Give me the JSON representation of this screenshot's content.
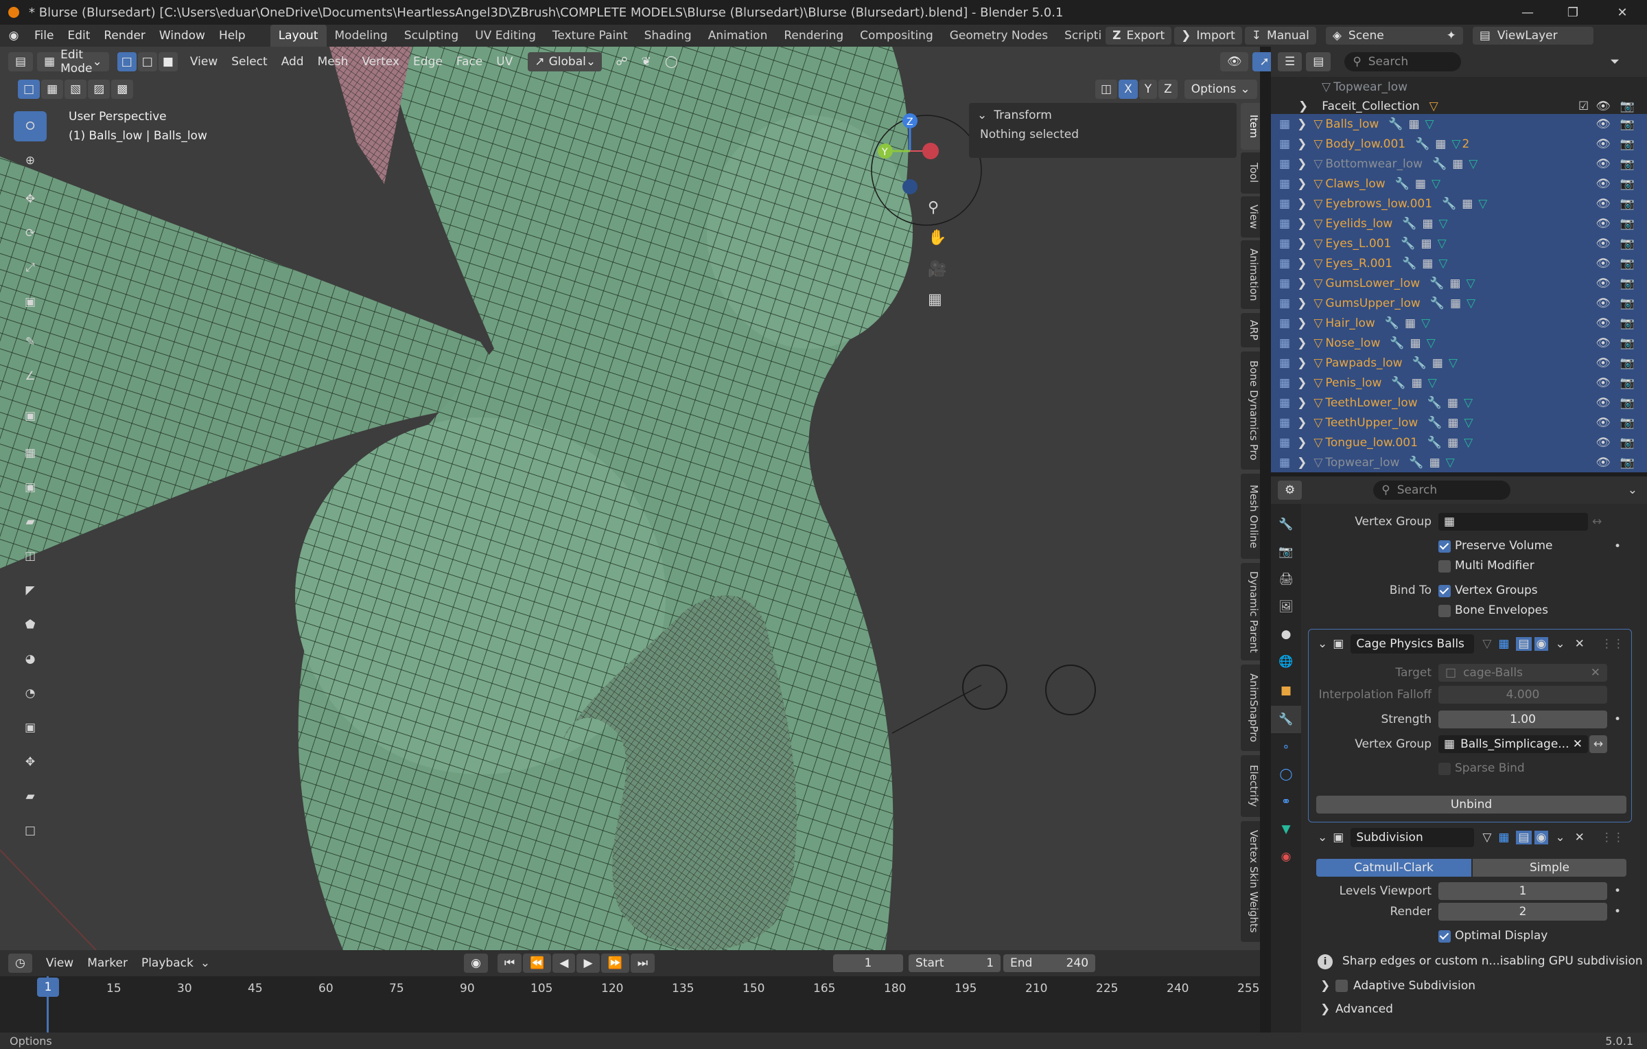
{
  "title_bar": {
    "text": "* Blurse (Blursedart) [C:\\Users\\eduar\\OneDrive\\Documents\\HeartlessAngel3D\\ZBrush\\COMPLETE MODELS\\Blurse (Blursedart)\\Blurse (Blursedart).blend] - Blender 5.0.1"
  },
  "menu": [
    "File",
    "Edit",
    "Render",
    "Window",
    "Help"
  ],
  "workspaces": [
    "Layout",
    "Modeling",
    "Sculpting",
    "UV Editing",
    "Texture Paint",
    "Shading",
    "Animation",
    "Rendering",
    "Compositing",
    "Geometry Nodes",
    "Scripting"
  ],
  "top_right": {
    "export": "Export",
    "import": "Import",
    "manual": "Manual",
    "scene": "Scene",
    "view_layer": "ViewLayer"
  },
  "viewport_header": {
    "mode": "Edit Mode",
    "menus": [
      "View",
      "Select",
      "Add",
      "Mesh",
      "Vertex",
      "Edge",
      "Face",
      "UV"
    ],
    "orientation": "Global",
    "options": "Options",
    "axes": [
      "X",
      "Y",
      "Z"
    ]
  },
  "viewport": {
    "perspective": "User Perspective",
    "object_info": "(1) Balls_low | Balls_low"
  },
  "n_panel": {
    "section": "Transform",
    "message": "Nothing selected",
    "tabs": [
      "Item",
      "Tool",
      "View",
      "Animation",
      "ARP",
      "Bone Dynamics Pro",
      "Mesh Online",
      "Dynamic Parent",
      "AnimSnapPro",
      "Electrify",
      "Vertex Skin Weights"
    ]
  },
  "outliner": {
    "search_placeholder": "Search",
    "top_partial": "Topwear_low",
    "collection": "Faceit_Collection",
    "items": [
      "Balls_low",
      "Body_low.001",
      "Bottomwear_low",
      "Claws_low",
      "Eyebrows_low.001",
      "Eyelids_low",
      "Eyes_L.001",
      "Eyes_R.001",
      "GumsLower_low",
      "GumsUpper_low",
      "Hair_low",
      "Nose_low",
      "Pawpads_low",
      "Penis_low",
      "TeethLower_low",
      "TeethUpper_low",
      "Tongue_low.001",
      "Topwear_low"
    ],
    "body_badge": "2"
  },
  "properties": {
    "search_placeholder": "Search",
    "vertex_group_label": "Vertex Group",
    "preserve_volume": "Preserve Volume",
    "multi_modifier": "Multi Modifier",
    "bind_to_label": "Bind To",
    "vertex_groups": "Vertex Groups",
    "bone_envelopes": "Bone Envelopes",
    "mod1": {
      "name": "Cage Physics Balls",
      "target_label": "Target",
      "target": "cage-Balls",
      "interp_label": "Interpolation Falloff",
      "interp": "4.000",
      "strength_label": "Strength",
      "strength": "1.00",
      "vg_label": "Vertex Group",
      "vg": "Balls_Simplicage...",
      "sparse": "Sparse Bind",
      "unbind": "Unbind"
    },
    "mod2": {
      "name": "Subdivision",
      "catmull": "Catmull-Clark",
      "simple": "Simple",
      "levels_label": "Levels Viewport",
      "levels": "1",
      "render_label": "Render",
      "render": "2",
      "optimal": "Optimal Display",
      "warning": "Sharp edges or custom n...isabling GPU subdivision",
      "adaptive": "Adaptive Subdivision",
      "advanced": "Advanced"
    }
  },
  "timeline": {
    "menus": [
      "View",
      "Marker",
      "Playback"
    ],
    "current_frame": "1",
    "start_label": "Start",
    "start": "1",
    "end_label": "End",
    "end": "240",
    "ticks": [
      "1",
      "15",
      "30",
      "45",
      "60",
      "75",
      "90",
      "105",
      "120",
      "135",
      "150",
      "165",
      "180",
      "195",
      "210",
      "225",
      "240",
      "255"
    ]
  },
  "status": {
    "left": "Options",
    "version": "5.0.1"
  },
  "colors": {
    "accent": "#4772b3",
    "object_orange": "#e8a53f",
    "mesh_green": "#6b9a7a",
    "selected_row": "#334d80"
  }
}
